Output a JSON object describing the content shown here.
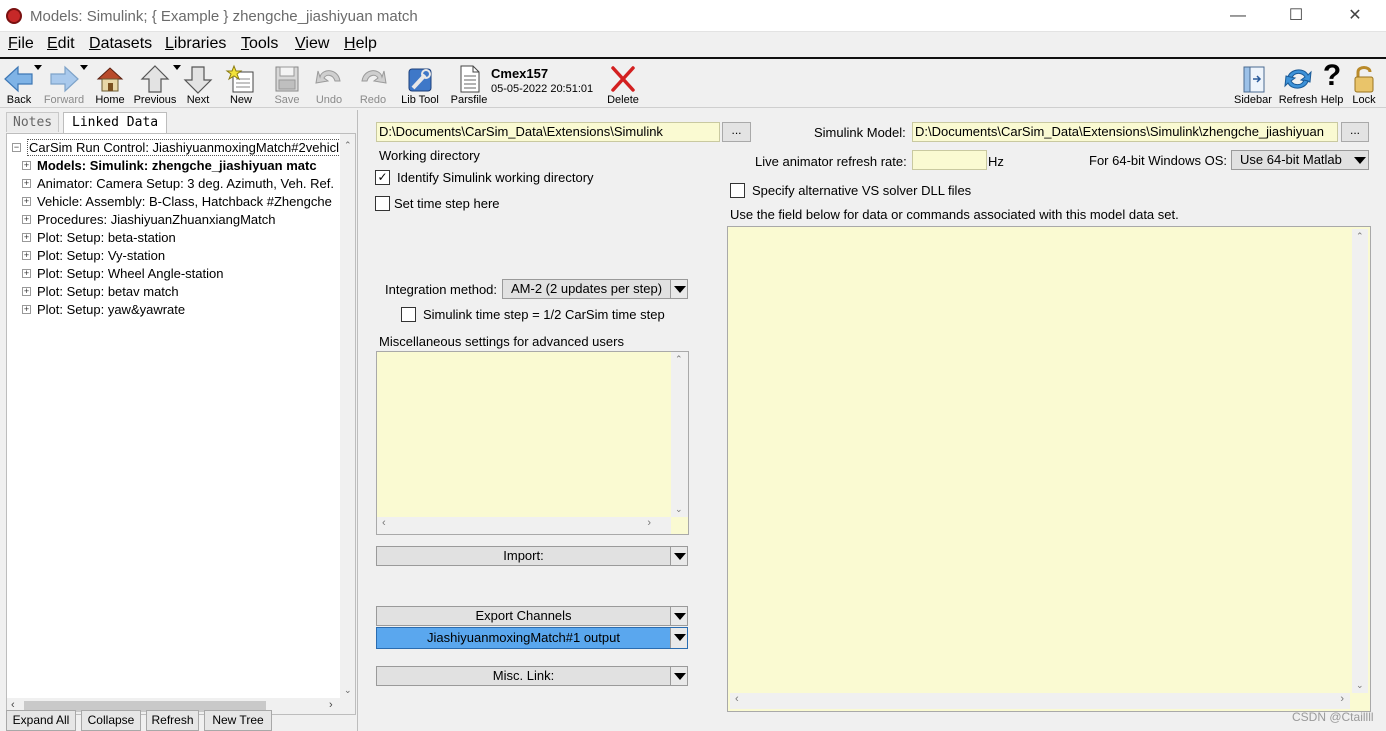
{
  "window": {
    "title": "Models: Simulink;  { Example }   zhengche_jiashiyuan match",
    "minimize": "—",
    "maximize": "☐",
    "close": "✕"
  },
  "menu": [
    "File",
    "Edit",
    "Datasets",
    "Libraries",
    "Tools",
    "View",
    "Help"
  ],
  "toolbar": {
    "back": "Back",
    "forward": "Forward",
    "home": "Home",
    "previous": "Previous",
    "next": "Next",
    "new": "New",
    "save": "Save",
    "undo": "Undo",
    "redo": "Redo",
    "lib_tool": "Lib Tool",
    "parsfile": "Parsfile",
    "dataset_name": "Cmex157",
    "dataset_date": "05-05-2022 20:51:01",
    "delete": "Delete",
    "sidebar": "Sidebar",
    "refresh": "Refresh",
    "help": "Help",
    "lock": "Lock"
  },
  "left_panel": {
    "tabs": [
      "Notes",
      "Linked Data"
    ],
    "tree_root": "CarSim Run Control: JiashiyuanmoxingMatch#2vehicl",
    "tree_items": [
      "Models: Simulink: zhengche_jiashiyuan matc",
      "Animator: Camera Setup: 3 deg. Azimuth, Veh. Ref.",
      "Vehicle: Assembly: B-Class, Hatchback #Zhengche",
      "Procedures: JiashiyuanZhuanxiangMatch",
      "Plot: Setup: beta-station",
      "Plot: Setup: Vy-station",
      "Plot: Setup: Wheel Angle-station",
      "Plot: Setup: betav match",
      "Plot: Setup: yaw&yawrate"
    ],
    "buttons": [
      "Expand All",
      "Collapse",
      "Refresh",
      "New Tree"
    ]
  },
  "center": {
    "working_dir_value": "D:\\Documents\\CarSim_Data\\Extensions\\Simulink",
    "browse": "...",
    "working_dir_label": "Working directory",
    "identify_label": "Identify Simulink working directory",
    "identify_checked": true,
    "time_step_label": "Set time step here",
    "time_step_checked": false,
    "integration_label": "Integration method:",
    "integration_value": "AM-2 (2 updates per step)",
    "half_step_label": "Simulink time step = 1/2 CarSim time step",
    "half_step_checked": false,
    "misc_label": "Miscellaneous settings for advanced users",
    "import_label": "Import:",
    "export_label": "Export Channels",
    "export_value": "JiashiyuanmoxingMatch#1 output",
    "misc_link_label": "Misc. Link:"
  },
  "right": {
    "model_label": "Simulink Model:",
    "model_value": "D:\\Documents\\CarSim_Data\\Extensions\\Simulink\\zhengche_jiashiyuan",
    "browse": "...",
    "refresh_rate_label": "Live animator refresh rate:",
    "refresh_rate_value": "",
    "hz": "Hz",
    "os_label": "For 64-bit Windows OS:",
    "os_value": "Use 64-bit Matlab",
    "alt_dll_label": "Specify alternative VS solver DLL files",
    "alt_dll_checked": false,
    "notes_label": "Use the field below  for data or commands associated with this model data set."
  },
  "watermark": "CSDN @Ctaillll",
  "colors": {
    "field_bg": "#fafad2",
    "highlight_blue": "#5aa7ee",
    "delete_red": "#d32020"
  }
}
